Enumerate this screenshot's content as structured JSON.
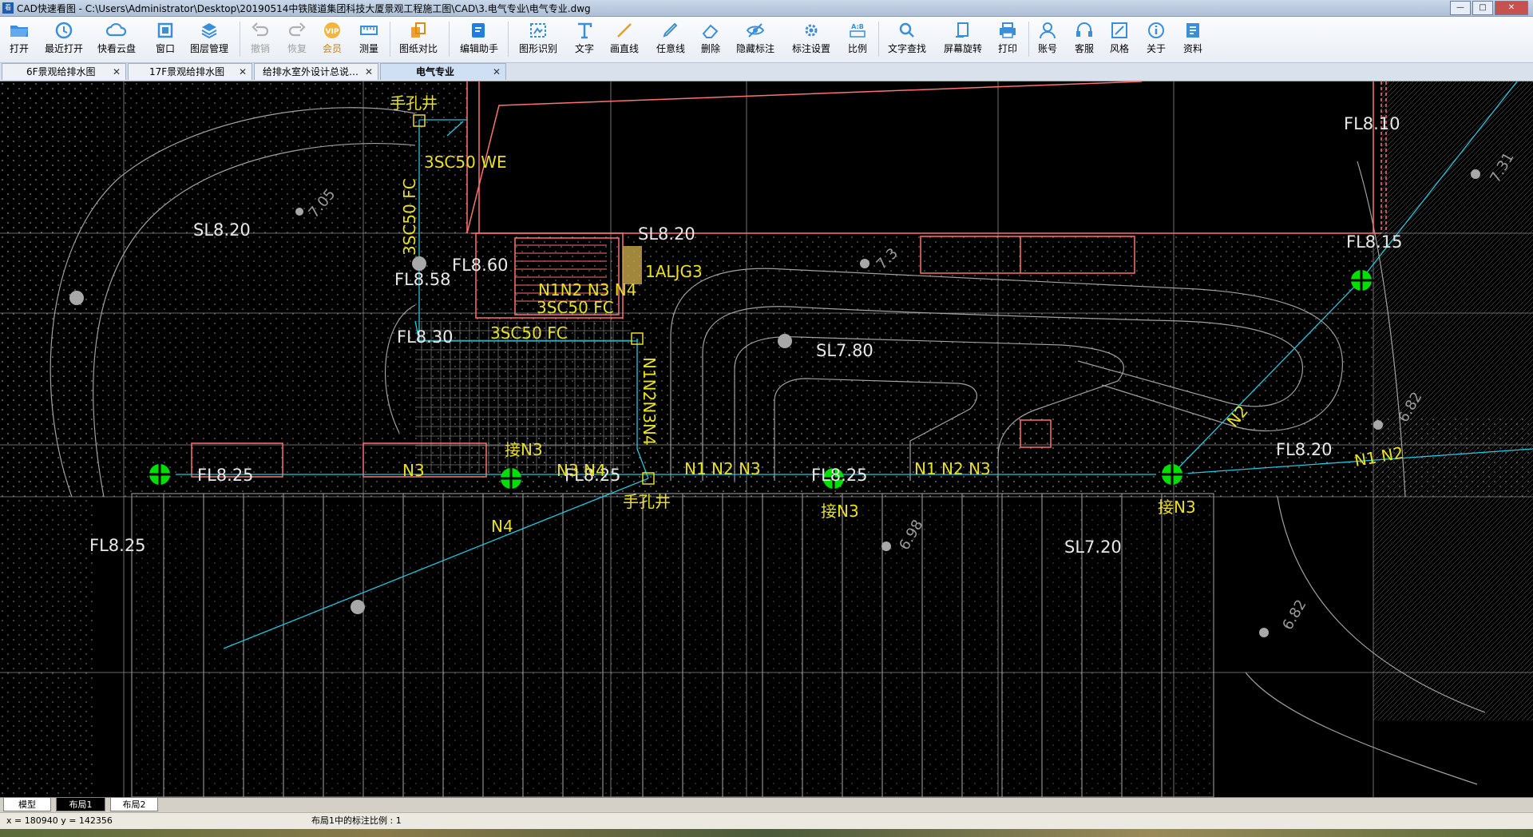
{
  "window": {
    "title": "CAD快速看图 - C:\\Users\\Administrator\\Desktop\\20190514中铁隧道集团科技大厦景观工程施工图\\CAD\\3.电气专业\\电气专业.dwg",
    "app_icon": "cad-app-icon",
    "controls": {
      "minimize": "—",
      "maximize": "□",
      "close": "✕"
    }
  },
  "toolbar": {
    "open": "打开",
    "recent": "最近打开",
    "cloud": "快看云盘",
    "window": "窗口",
    "layers": "图层管理",
    "undo": "撤销",
    "redo": "恢复",
    "vip": "会员",
    "measure": "测量",
    "compare": "图纸对比",
    "assistant": "编辑助手",
    "recognize": "图形识别",
    "text": "文字",
    "line": "画直线",
    "freeline": "任意线",
    "delete": "删除",
    "hide": "隐藏标注",
    "annot_settings": "标注设置",
    "ratio": "比例",
    "find_text": "文字查找",
    "rotate": "屏幕旋转",
    "print": "打印",
    "account": "账号",
    "service": "客服",
    "style": "风格",
    "about": "关于",
    "docs": "资料",
    "vip_badge": "VIP",
    "ratio_badge": "A:B"
  },
  "tabs": [
    {
      "label": "6F景观给排水图",
      "close": "✕"
    },
    {
      "label": "17F景观给排水图",
      "close": "✕"
    },
    {
      "label": "给排水室外设计总说…",
      "close": "✕"
    },
    {
      "label": "电气专业",
      "close": "✕",
      "active": true
    }
  ],
  "drawing": {
    "labels": {
      "sl_820_left": "SL8.20",
      "sl_820_mid": "SL8.20",
      "sl_780": "SL7.80",
      "sl_720": "SL7.20",
      "fl_810": "FL8.10",
      "fl_815": "FL8.15",
      "fl_860": "FL8.60",
      "fl_858": "FL8.58",
      "fl_830": "FL8.30",
      "fl_825_a": "FL8.25",
      "fl_825_b": "FL8.25",
      "fl_825_c": "FL8.25",
      "fl_825_d": "FL8.25",
      "fl_820": "FL8.20",
      "handhole_top": "手孔井",
      "handhole_bottom": "手孔井",
      "conduit_we": "3SC50 WE",
      "conduit_fc_vertical": "3SC50 FC",
      "conduit_fc_mid": "3SC50 FC",
      "conduit_fc_low": "3SC50 FC",
      "n1n2n3n4_box": "N1N2 N3 N4",
      "aljg": "1ALJG3",
      "n1n2n3n4_vertical": "N1N2N3N4",
      "n3_a": "N3",
      "n3_b": "接N3",
      "n3n4": "N3 N4",
      "n4": "N4",
      "n123_a": "N1 N2 N3",
      "n123_b": "N1 N2 N3",
      "n3_c": "接N3",
      "n3_d": "接N3",
      "n2": "N2",
      "n1n2": "N1 N2",
      "contour_705": "7.05",
      "contour_731": "7.31",
      "contour_682a": "6.82",
      "contour_682b": "6.82",
      "contour_698": "6.98",
      "contour_73": "7.3"
    }
  },
  "layout_tabs": {
    "model": "模型",
    "layout1": "布局1",
    "layout2": "布局2"
  },
  "status": {
    "coords": "x = 180940  y = 142356",
    "scale": "布局1中的标注比例 : 1"
  },
  "colors": {
    "cad_bg": "#000000",
    "wall_red": "#ff7070",
    "cable_cyan": "#20c8e0",
    "annot_yellow": "#e8e020",
    "light_green": "#00e000",
    "grid_gray": "#8c8c8c",
    "contour_gray": "#9a9a9a"
  }
}
